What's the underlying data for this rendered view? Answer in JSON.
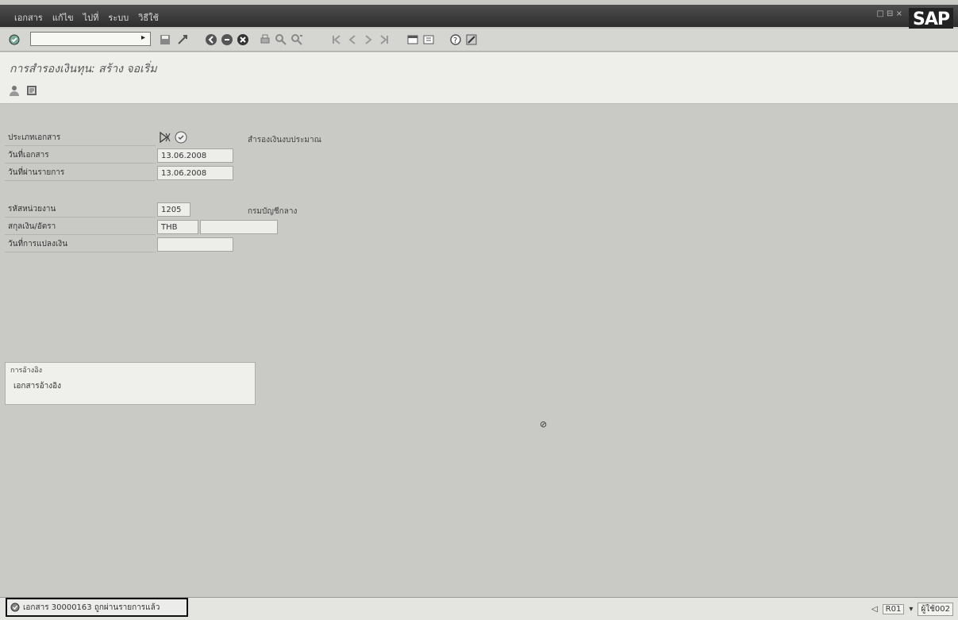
{
  "window": {
    "menu": [
      "เอกสาร",
      "แก้ไข",
      "ไปที่",
      "ระบบ",
      "วิธีใช้"
    ],
    "logo": "SAP",
    "controls": "□ ⊟ ×"
  },
  "toolbar": {
    "command_value": "",
    "icons": [
      "enter-icon",
      "save-icon",
      "back-icon",
      "exit-icon",
      "cancel-icon",
      "print-icon",
      "find-icon",
      "find-next-icon",
      "first-page-icon",
      "prev-page-icon",
      "next-page-icon",
      "last-page-icon",
      "new-session-icon",
      "shortcut-icon",
      "help-icon",
      "layout-icon"
    ]
  },
  "header": {
    "title": "การสำรองเงินทุน: สร้าง จอเริ่ม",
    "app_icons": [
      "person-icon",
      "document-icon"
    ]
  },
  "form": {
    "fields": [
      {
        "label": "ประเภทเอกสาร",
        "value": "",
        "desc": "สำรองเงินงบประมาณ"
      },
      {
        "label": "วันที่เอกสาร",
        "value": "13.06.2008"
      },
      {
        "label": "วันที่ผ่านรายการ",
        "value": "13.06.2008"
      },
      {
        "label": "รหัสหน่วยงาน",
        "value": "1205",
        "desc": "กรมบัญชีกลาง"
      },
      {
        "label": "สกุลเงิน/อัตรา",
        "value": "THB"
      },
      {
        "label": "วันที่การแปลงเงิน",
        "value": ""
      }
    ]
  },
  "reference_group": {
    "title": "การอ้างอิง",
    "item": "เอกสารอ้างอิง"
  },
  "status": {
    "message": "เอกสาร 30000163 ถูกผ่านรายการแล้ว",
    "system": "R01",
    "client": "ผู้ใช้002"
  },
  "colors": {
    "menubar": "#3c3c3c",
    "background": "#c9c9c6",
    "title_area": "#eeeeeb"
  }
}
